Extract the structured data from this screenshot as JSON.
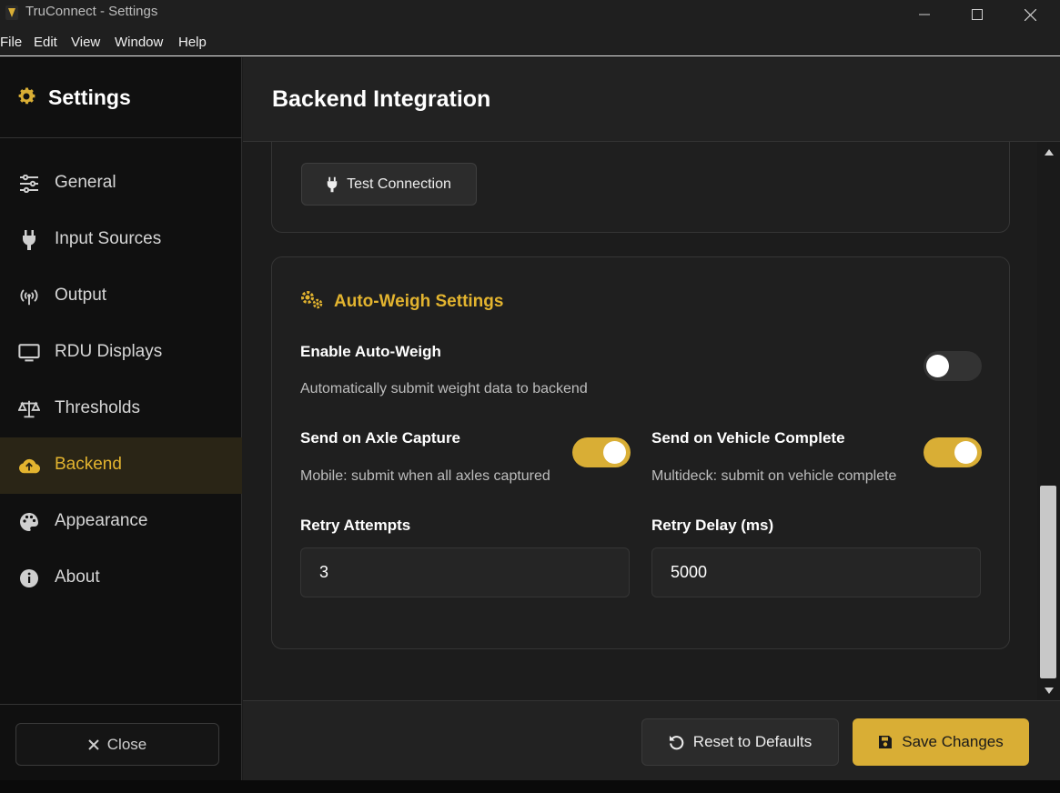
{
  "window": {
    "title": "TruConnect - Settings"
  },
  "menu": [
    "File",
    "Edit",
    "View",
    "Window",
    "Help"
  ],
  "sidebar": {
    "title": "Settings",
    "items": [
      {
        "label": "General",
        "icon": "sliders-icon"
      },
      {
        "label": "Input Sources",
        "icon": "plug-icon"
      },
      {
        "label": "Output",
        "icon": "broadcast-icon"
      },
      {
        "label": "RDU Displays",
        "icon": "monitor-icon"
      },
      {
        "label": "Thresholds",
        "icon": "scale-icon"
      },
      {
        "label": "Backend",
        "icon": "cloud-upload-icon"
      },
      {
        "label": "Appearance",
        "icon": "palette-icon"
      },
      {
        "label": "About",
        "icon": "info-icon"
      }
    ],
    "active_item": "Backend",
    "close_label": "Close"
  },
  "main": {
    "title": "Backend Integration",
    "test_connection_label": "Test Connection",
    "auto_weigh": {
      "title": "Auto-Weigh Settings",
      "enable_label": "Enable Auto-Weigh",
      "enable_desc": "Automatically submit weight data to backend",
      "enable_on": false,
      "axle_label": "Send on Axle Capture",
      "axle_desc": "Mobile: submit when all axles captured",
      "axle_on": true,
      "vehicle_label": "Send on Vehicle Complete",
      "vehicle_desc": "Multideck: submit on vehicle complete",
      "vehicle_on": true,
      "retry_attempts_label": "Retry Attempts",
      "retry_attempts_value": "3",
      "retry_delay_label": "Retry Delay (ms)",
      "retry_delay_value": "5000"
    }
  },
  "footer": {
    "reset_label": "Reset to Defaults",
    "save_label": "Save Changes"
  },
  "colors": {
    "accent": "#d9ae35",
    "background": "#1c1c1c",
    "sidebar": "#101010"
  }
}
